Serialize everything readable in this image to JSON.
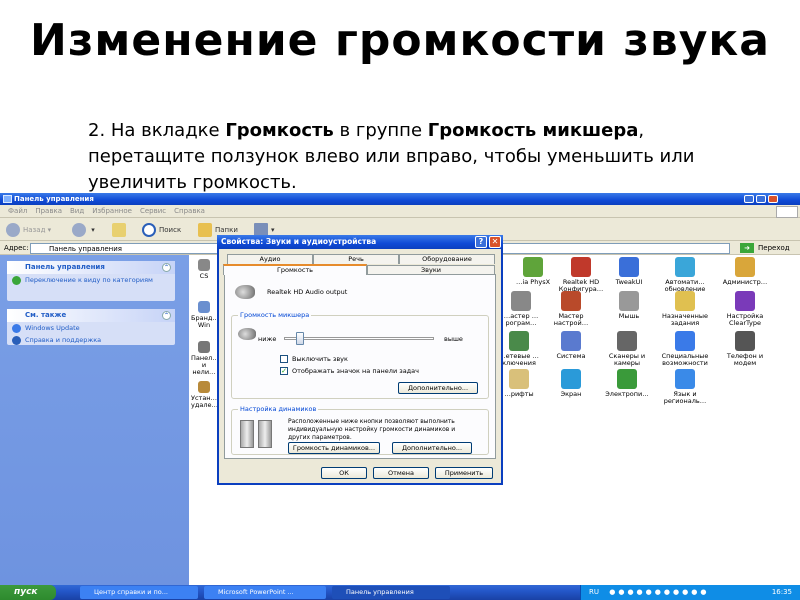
{
  "slide": {
    "title": "Изменение громкости звука",
    "step_num": "2. На вкладке ",
    "step_b1": "Громкость",
    "step_t2": " в группе ",
    "step_b2": "Громкость микшера",
    "step_t3": ", перетащите ползунок влево или вправо, чтобы уменьшить или увеличить громкость."
  },
  "window": {
    "title": "Панель управления",
    "menu": [
      "Файл",
      "Правка",
      "Вид",
      "Избранное",
      "Сервис",
      "Справка"
    ],
    "toolbar": {
      "back": "Назад",
      "search": "Поиск",
      "folders": "Папки"
    },
    "address_label": "Адрес:",
    "address_value": "Панель управления",
    "go_label": "Переход"
  },
  "left_pane": {
    "box1_title": "Панель управления",
    "box1_items": [
      "Переключение к виду по категориям"
    ],
    "box2_title": "См. также",
    "box2_items": [
      "Windows Update",
      "Справка и поддержка"
    ]
  },
  "icons": [
    {
      "label": "CS",
      "color": "#888"
    },
    {
      "label": "Бранд… Win",
      "color": "#6a8fcf"
    },
    {
      "label": "Панел… и нели…",
      "color": "#777"
    },
    {
      "label": "Устан… удале…",
      "color": "#b88a3a"
    },
    {
      "label": "…ia PhysX",
      "color": "#5fa43a"
    },
    {
      "label": "Realtek HD Конфигура…",
      "color": "#c0392b"
    },
    {
      "label": "TweakUI",
      "color": "#3a6fd9"
    },
    {
      "label": "Автомати… обновление",
      "color": "#3aa6d9"
    },
    {
      "label": "Администр…",
      "color": "#d9a63a"
    },
    {
      "label": "…астер …рограм…",
      "color": "#888"
    },
    {
      "label": "Мастер настрой…",
      "color": "#b94a2a"
    },
    {
      "label": "Мышь",
      "color": "#999"
    },
    {
      "label": "Назначенные задания",
      "color": "#e0c050"
    },
    {
      "label": "Настройка ClearType",
      "color": "#7a3ab9"
    },
    {
      "label": "…етевые …ключения",
      "color": "#4a8a4a"
    },
    {
      "label": "Система",
      "color": "#5a7acf"
    },
    {
      "label": "Сканеры и камеры",
      "color": "#666"
    },
    {
      "label": "Специальные возможности",
      "color": "#3a7ae8"
    },
    {
      "label": "Телефон и модем",
      "color": "#555"
    },
    {
      "label": "…рифты",
      "color": "#d9c07a"
    },
    {
      "label": "Экран",
      "color": "#2a9ad9"
    },
    {
      "label": "Электропи…",
      "color": "#3a9a3a"
    },
    {
      "label": "Язык и региональ…",
      "color": "#3a8ae8"
    }
  ],
  "dialog": {
    "title": "Свойства: Звуки и аудиоустройства",
    "tabs_top": [
      "Аудио",
      "Речь",
      "Оборудование"
    ],
    "tabs_bottom": [
      "Громкость",
      "Звуки"
    ],
    "device": "Realtek HD Audio output",
    "mixer_group": "Громкость микшера",
    "low": "ниже",
    "high": "выше",
    "mixer_level": 0.08,
    "mute": "Выключить звук",
    "mute_checked": false,
    "show_icon": "Отображать значок на панели задач",
    "show_icon_checked": true,
    "advanced1": "Дополнительно...",
    "speakers_group": "Настройка динамиков",
    "speakers_text": "Расположенные ниже кнопки позволяют выполнить индивидуальную настройку громкости динамиков и других параметров.",
    "speaker_volume": "Громкость динамиков...",
    "advanced2": "Дополнительно...",
    "ok": "ОК",
    "cancel": "Отмена",
    "apply": "Применить"
  },
  "taskbar": {
    "start": "пуск",
    "tasks": [
      "Центр справки и по...",
      "Microsoft PowerPoint ...",
      "Панель управления"
    ],
    "lang": "RU",
    "clock": "16:35"
  }
}
